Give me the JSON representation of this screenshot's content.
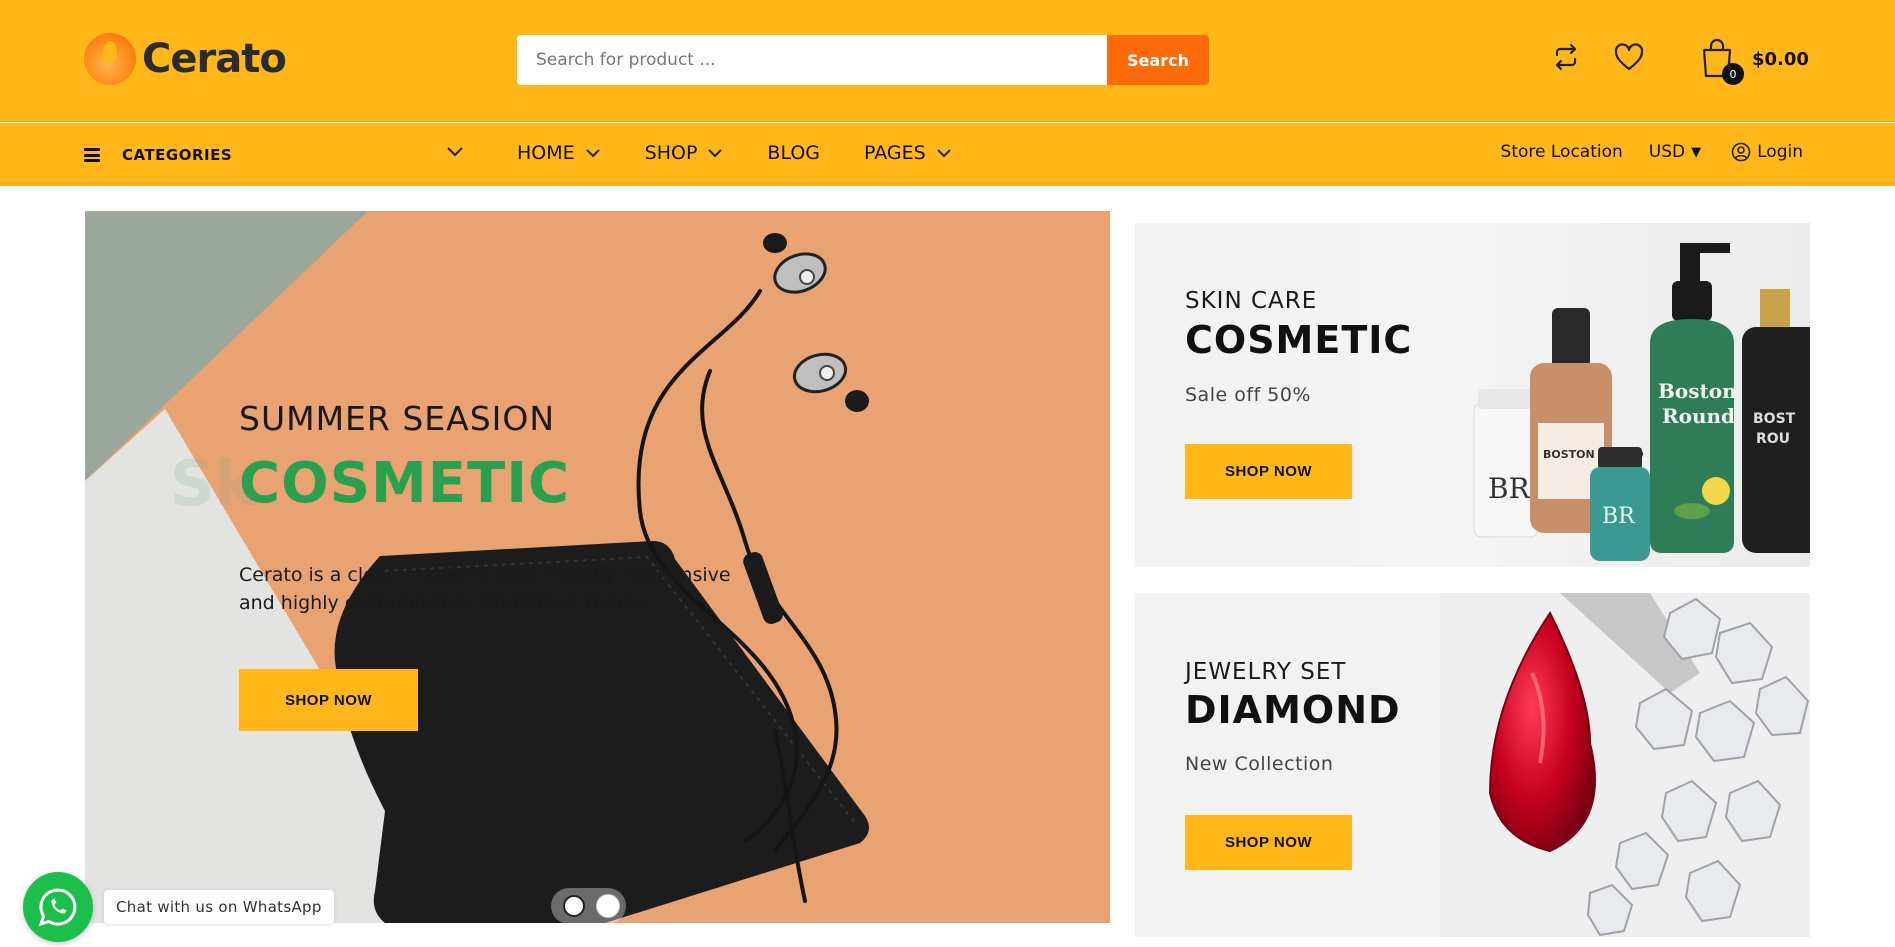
{
  "header": {
    "logo_text": "Cerato",
    "search": {
      "placeholder": "Search for product ...",
      "button_label": "Search"
    },
    "icons": [
      "compare-icon",
      "heart-icon",
      "cart-icon"
    ],
    "cart": {
      "count": "0",
      "total": "$0.00"
    }
  },
  "nav": {
    "categories_label": "CATEGORIES",
    "menu": [
      {
        "label": "HOME",
        "has_dropdown": true
      },
      {
        "label": "SHOP",
        "has_dropdown": true
      },
      {
        "label": "BLOG",
        "has_dropdown": false
      },
      {
        "label": "PAGES",
        "has_dropdown": true
      }
    ],
    "store_location": "Store Location",
    "currency": "USD",
    "login": "Login"
  },
  "hero": {
    "subtitle": "SUMMER SEASION",
    "ghost_text": "Sk",
    "title": "COSMETIC",
    "description_line1": "Cerato is a clean, modern, user friendly, responsive",
    "description_line2": "and highly customizable WordPress Theme.",
    "button_label": "SHOP NOW",
    "slides": 2,
    "active_slide": 2
  },
  "banners": [
    {
      "subtitle": "SKIN CARE",
      "title": "COSMETIC",
      "description": "Sale off 50%",
      "button_label": "SHOP NOW"
    },
    {
      "subtitle": "JEWELRY SET",
      "title": "DIAMOND",
      "description": "New Collection",
      "button_label": "SHOP NOW"
    }
  ],
  "product_art": {
    "bottle_labels": [
      "Boston",
      "Round",
      "BR",
      "BOSTON ROUND",
      "BR",
      "BOST",
      "ROU"
    ]
  },
  "whatsapp": {
    "label": "Chat with us on WhatsApp"
  },
  "colors": {
    "primary": "#FFB719",
    "accent": "#FF6B0A",
    "hero_title": "#2AA04F",
    "whatsapp": "#1DBF4C"
  }
}
